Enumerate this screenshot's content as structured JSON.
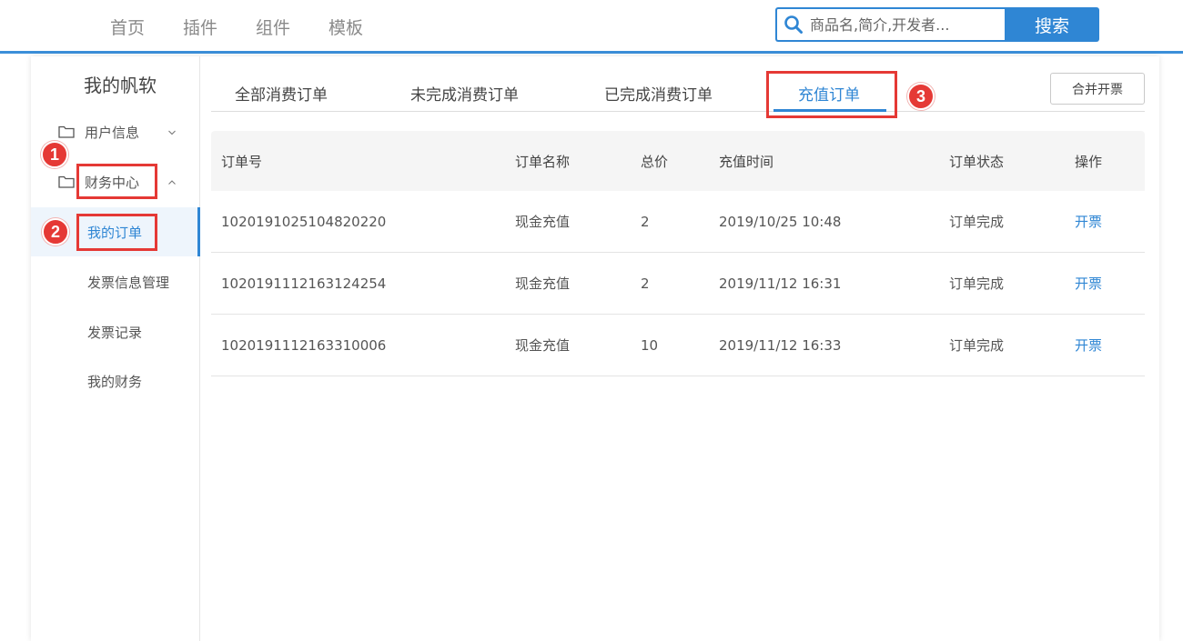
{
  "topnav": {
    "items": [
      "首页",
      "插件",
      "组件",
      "模板"
    ]
  },
  "search": {
    "placeholder": "商品名,简介,开发者...",
    "button_label": "搜索"
  },
  "sidebar": {
    "title": "我的帆软",
    "groups": [
      {
        "label": "用户信息"
      },
      {
        "label": "财务中心"
      }
    ],
    "subitems": [
      {
        "label": "我的订单"
      },
      {
        "label": "发票信息管理"
      },
      {
        "label": "发票记录"
      },
      {
        "label": "我的财务"
      }
    ]
  },
  "tabs": {
    "items": [
      "全部消费订单",
      "未完成消费订单",
      "已完成消费订单",
      "充值订单"
    ],
    "active_index": 3
  },
  "merge_button_label": "合并开票",
  "table": {
    "columns": [
      "订单号",
      "订单名称",
      "总价",
      "充值时间",
      "订单状态",
      "操作"
    ],
    "rows": [
      {
        "order_no": "1020191025104820220",
        "name": "现金充值",
        "total": "2",
        "time": "2019/10/25 10:48",
        "status": "订单完成",
        "action": "开票"
      },
      {
        "order_no": "1020191112163124254",
        "name": "现金充值",
        "total": "2",
        "time": "2019/11/12 16:31",
        "status": "订单完成",
        "action": "开票"
      },
      {
        "order_no": "1020191112163310006",
        "name": "现金充值",
        "total": "10",
        "time": "2019/11/12 16:33",
        "status": "订单完成",
        "action": "开票"
      }
    ]
  },
  "annotations": {
    "badges": [
      "1",
      "2",
      "3"
    ]
  },
  "colors": {
    "accent": "#2f86d4",
    "highlight": "#e53935"
  }
}
